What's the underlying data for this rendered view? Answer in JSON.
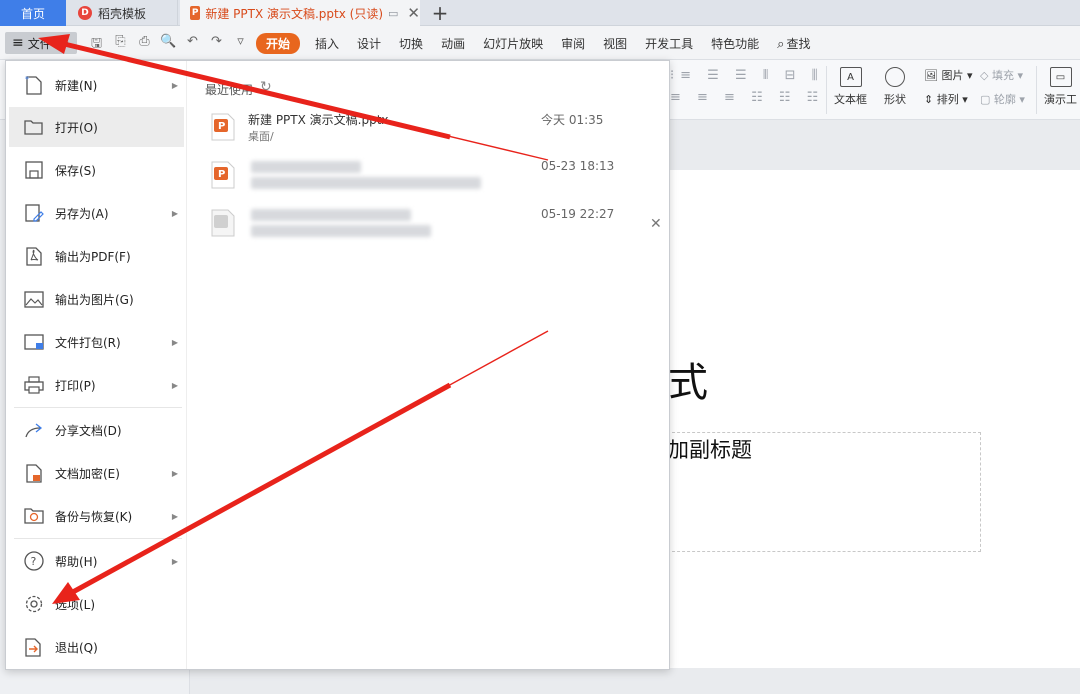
{
  "tabs": {
    "home": "首页",
    "template": "稻壳模板",
    "doc": "新建 PPTX 演示文稿.pptx (只读)"
  },
  "menubar": {
    "file": "文件",
    "ribbon_tabs": [
      "开始",
      "插入",
      "设计",
      "切换",
      "动画",
      "幻灯片放映",
      "审阅",
      "视图",
      "开发工具",
      "特色功能",
      "查找"
    ]
  },
  "ribbon": {
    "textbox": "文本框",
    "shape": "形状",
    "picture": "图片",
    "fill": "填充",
    "arrange": "排列",
    "outline": "轮廓",
    "present": "演示工"
  },
  "file_menu": {
    "items": [
      {
        "label": "新建(N)",
        "icon": "new-icon"
      },
      {
        "label": "打开(O)",
        "icon": "open-folder-icon"
      },
      {
        "label": "保存(S)",
        "icon": "save-icon"
      },
      {
        "label": "另存为(A)",
        "icon": "save-as-icon"
      },
      {
        "label": "输出为PDF(F)",
        "icon": "pdf-export-icon"
      },
      {
        "label": "输出为图片(G)",
        "icon": "image-export-icon"
      },
      {
        "label": "文件打包(R)",
        "icon": "package-icon"
      },
      {
        "label": "打印(P)",
        "icon": "print-icon"
      },
      {
        "label": "分享文档(D)",
        "icon": "share-icon"
      },
      {
        "label": "文档加密(E)",
        "icon": "encrypt-icon"
      },
      {
        "label": "备份与恢复(K)",
        "icon": "backup-icon"
      },
      {
        "label": "帮助(H)",
        "icon": "help-icon"
      },
      {
        "label": "选项(L)",
        "icon": "gear-icon"
      },
      {
        "label": "退出(Q)",
        "icon": "exit-icon"
      }
    ],
    "recent_title": "最近使用",
    "recent_files": [
      {
        "name": "新建 PPTX 演示文稿.pptx",
        "path": "桌面/",
        "time": "今天 01:35"
      },
      {
        "name": "",
        "path": "",
        "time": "05-23 18:13"
      },
      {
        "name": "",
        "path": "",
        "time": "05-19 22:27"
      }
    ]
  },
  "slide": {
    "title_fragment": "式",
    "subtitle_fragment": "加副标题"
  },
  "colors": {
    "accent": "#3f7ee8",
    "active_tab": "#e8661e",
    "annotation_arrow": "#e8231b"
  }
}
